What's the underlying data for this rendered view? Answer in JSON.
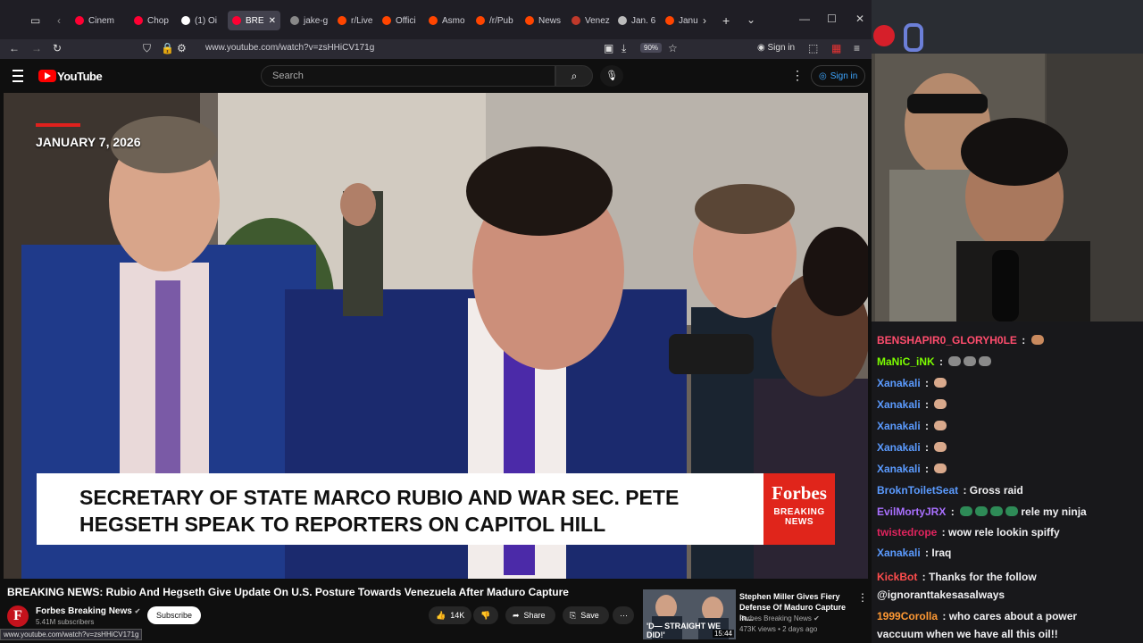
{
  "browser": {
    "tabs": [
      {
        "label": "Cinem",
        "color": "#ff0033"
      },
      {
        "label": "Chop",
        "color": "#ff0033"
      },
      {
        "label": "(1) Oi",
        "color": "#ffffff"
      },
      {
        "label": "BRE",
        "color": "#ff0033"
      },
      {
        "label": "jake-g",
        "color": "#888888"
      },
      {
        "label": "r/Live",
        "color": "#ff4500"
      },
      {
        "label": "Offici",
        "color": "#ff4500"
      },
      {
        "label": "Asmo",
        "color": "#ff4500"
      },
      {
        "label": "/r/Pub",
        "color": "#ff4500"
      },
      {
        "label": "News",
        "color": "#ff4500"
      },
      {
        "label": "Venez",
        "color": "#c0392b"
      },
      {
        "label": "Jan. 6",
        "color": "#bbbbbb"
      },
      {
        "label": "Janu",
        "color": "#ff4500"
      }
    ],
    "url": "www.youtube.com/watch?v=zsHHiCV171g",
    "zoom": "90%",
    "sign_in": "Sign in",
    "status_url": "www.youtube.com/watch?v=zsHHiCV171g"
  },
  "youtube": {
    "logo_text": "YouTube",
    "search_placeholder": "Search",
    "sign_in": "Sign in"
  },
  "video": {
    "date": "JANUARY 7, 2026",
    "headline": "SECRETARY OF STATE MARCO RUBIO AND WAR SEC. PETE HEGSETH SPEAK TO REPORTERS ON CAPITOL HILL",
    "brand": "Forbes",
    "brand_sub": "BREAKING NEWS",
    "title": "BREAKING NEWS: Rubio And Hegseth Give Update On U.S. Posture Towards Venezuela After Maduro Capture",
    "channel": {
      "avatar": "F",
      "name": "Forbes Breaking News",
      "subs": "5.41M subscribers"
    },
    "subscribe": "Subscribe",
    "likes": "14K",
    "share": "Share",
    "save": "Save"
  },
  "recommended": {
    "thumb_text": "'D— STRAIGHT WE DID!'",
    "duration": "15:44",
    "title": "Stephen Miller Gives Fiery Defense Of Maduro Capture In...",
    "channel": "Forbes Breaking News",
    "meta": "473K views • 2 days ago"
  },
  "chat": [
    {
      "user": "BENSHAPIR0_GLORYH0LE",
      "color": "#ff4d6d",
      "text": "",
      "emotes": [
        "#c98a5e"
      ]
    },
    {
      "user": "MaNiC_iNK",
      "color": "#7cfc00",
      "text": "",
      "emotes": [
        "#8a8a8a",
        "#8a8a8a",
        "#8a8a8a"
      ]
    },
    {
      "user": "Xanakali",
      "color": "#5b9bff",
      "text": "",
      "emotes": [
        "#d9a98c"
      ]
    },
    {
      "user": "Xanakali",
      "color": "#5b9bff",
      "text": "",
      "emotes": [
        "#d9a98c"
      ]
    },
    {
      "user": "Xanakali",
      "color": "#5b9bff",
      "text": "",
      "emotes": [
        "#d9a98c"
      ]
    },
    {
      "user": "Xanakali",
      "color": "#5b9bff",
      "text": "",
      "emotes": [
        "#d9a98c"
      ]
    },
    {
      "user": "Xanakali",
      "color": "#5b9bff",
      "text": "",
      "emotes": [
        "#d9a98c"
      ]
    },
    {
      "user": "BroknToiletSeat",
      "color": "#5b9bff",
      "text": "Gross raid",
      "emotes": []
    },
    {
      "user": "EvilMortyJRX",
      "color": "#a970ff",
      "text": "rele my ninja",
      "emotes": [
        "#2e8b57",
        "#2e8b57",
        "#2e8b57",
        "#2e8b57"
      ]
    },
    {
      "user": "twistedrope",
      "color": "#e0245e",
      "text": "wow rele lookin spiffy",
      "emotes": []
    },
    {
      "user": "Xanakali",
      "color": "#5b9bff",
      "text": "Iraq",
      "emotes": []
    },
    {
      "user": "KickBot",
      "color": "#ff4d4d",
      "text": "Thanks for the follow @ignoranttakesasalways",
      "emotes": []
    },
    {
      "user": "1999Corolla",
      "color": "#ff9933",
      "text": "who cares about a power vaccuum when we have all this oil!!",
      "emotes": []
    }
  ]
}
